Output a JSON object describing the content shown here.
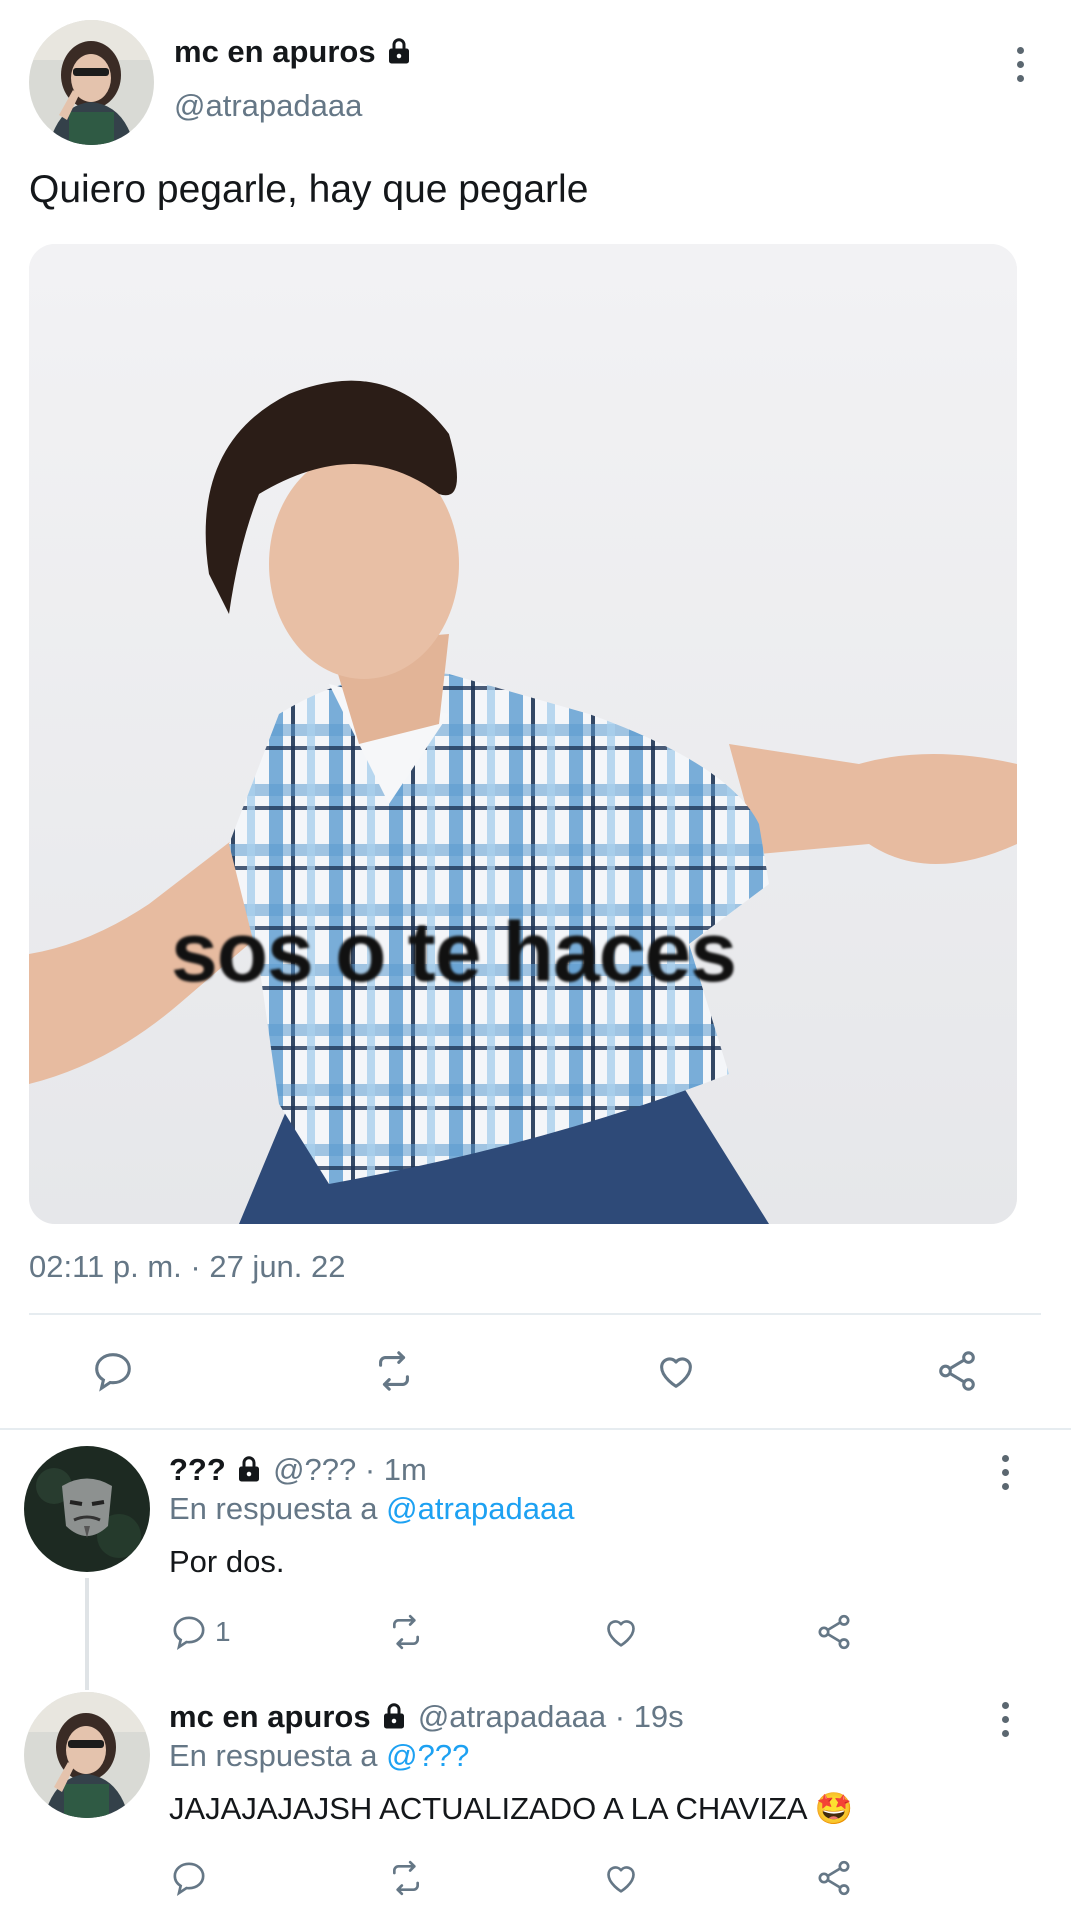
{
  "main_tweet": {
    "display_name": "mc en apuros",
    "handle": "@atrapadaaa",
    "text": "Quiero pegarle, hay que pegarle",
    "image_caption": "sos o te haces",
    "timestamp": "02:11 p. m. · 27 jun. 22",
    "actions": [
      "reply-icon",
      "retweet-icon",
      "like-icon",
      "share-icon"
    ]
  },
  "replies": [
    {
      "display_name": "???",
      "meta": "@??? · 1m",
      "reply_prefix": "En respuesta a",
      "reply_to": "@atrapadaaa",
      "text": "Por dos.",
      "reply_count": "1"
    },
    {
      "display_name": "mc en apuros",
      "meta": "@atrapadaaa · 19s",
      "reply_prefix": "En respuesta a",
      "reply_to": "@???",
      "text": "JAJAJAJAJSH ACTUALIZADO A LA CHAVIZA 🤩",
      "reply_count": ""
    }
  ],
  "colors": {
    "link": "#1da1f2",
    "muted": "#657786",
    "text": "#14171a",
    "divider": "#e6ecf0"
  }
}
